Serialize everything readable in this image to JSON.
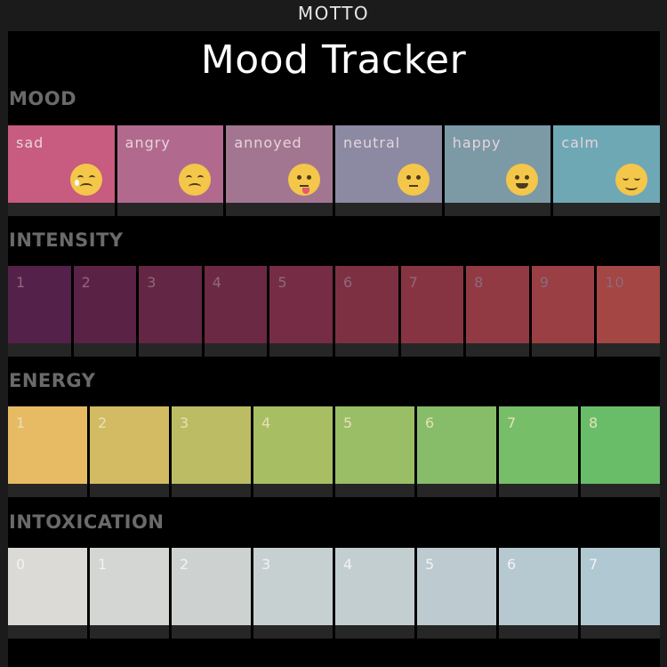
{
  "header": {
    "brand": "MOTTO",
    "title": "Mood Tracker"
  },
  "sections": {
    "mood": {
      "label": "MOOD",
      "items": [
        {
          "label": "sad",
          "color": "#c75b80",
          "emoji": "crying-face-icon"
        },
        {
          "label": "angry",
          "color": "#b16a8d",
          "emoji": "persevering-face-icon"
        },
        {
          "label": "annoyed",
          "color": "#a27690",
          "emoji": "tongue-out-face-icon"
        },
        {
          "label": "neutral",
          "color": "#8b8aa2",
          "emoji": "confused-face-icon"
        },
        {
          "label": "happy",
          "color": "#7b9aa6",
          "emoji": "smiling-face-icon"
        },
        {
          "label": "calm",
          "color": "#6fa8b5",
          "emoji": "blush-face-icon"
        }
      ]
    },
    "intensity": {
      "label": "INTENSITY",
      "items": [
        {
          "label": "1",
          "color": "#532149"
        },
        {
          "label": "2",
          "color": "#5a2245"
        },
        {
          "label": "3",
          "color": "#632644"
        },
        {
          "label": "4",
          "color": "#6c2943"
        },
        {
          "label": "5",
          "color": "#752c44"
        },
        {
          "label": "6",
          "color": "#7d3042"
        },
        {
          "label": "7",
          "color": "#873442"
        },
        {
          "label": "8",
          "color": "#913a44"
        },
        {
          "label": "9",
          "color": "#9a3f44"
        },
        {
          "label": "10",
          "color": "#a34644"
        }
      ]
    },
    "energy": {
      "label": "ENERGY",
      "items": [
        {
          "label": "1",
          "color": "#e6bb64"
        },
        {
          "label": "2",
          "color": "#d2bb62"
        },
        {
          "label": "3",
          "color": "#bcbc64"
        },
        {
          "label": "4",
          "color": "#a8be63"
        },
        {
          "label": "5",
          "color": "#9abe66"
        },
        {
          "label": "6",
          "color": "#87bc68"
        },
        {
          "label": "7",
          "color": "#77be69"
        },
        {
          "label": "8",
          "color": "#69bd69"
        }
      ]
    },
    "intoxication": {
      "label": "INTOXICATION",
      "items": [
        {
          "label": "0",
          "color": "#dcdad6"
        },
        {
          "label": "1",
          "color": "#d4d6d3"
        },
        {
          "label": "2",
          "color": "#cdd2d0"
        },
        {
          "label": "3",
          "color": "#c6d0d1"
        },
        {
          "label": "4",
          "color": "#c3ced1"
        },
        {
          "label": "5",
          "color": "#bdcbd0"
        },
        {
          "label": "6",
          "color": "#b6c8d0"
        },
        {
          "label": "7",
          "color": "#b0c8d1"
        }
      ]
    }
  }
}
